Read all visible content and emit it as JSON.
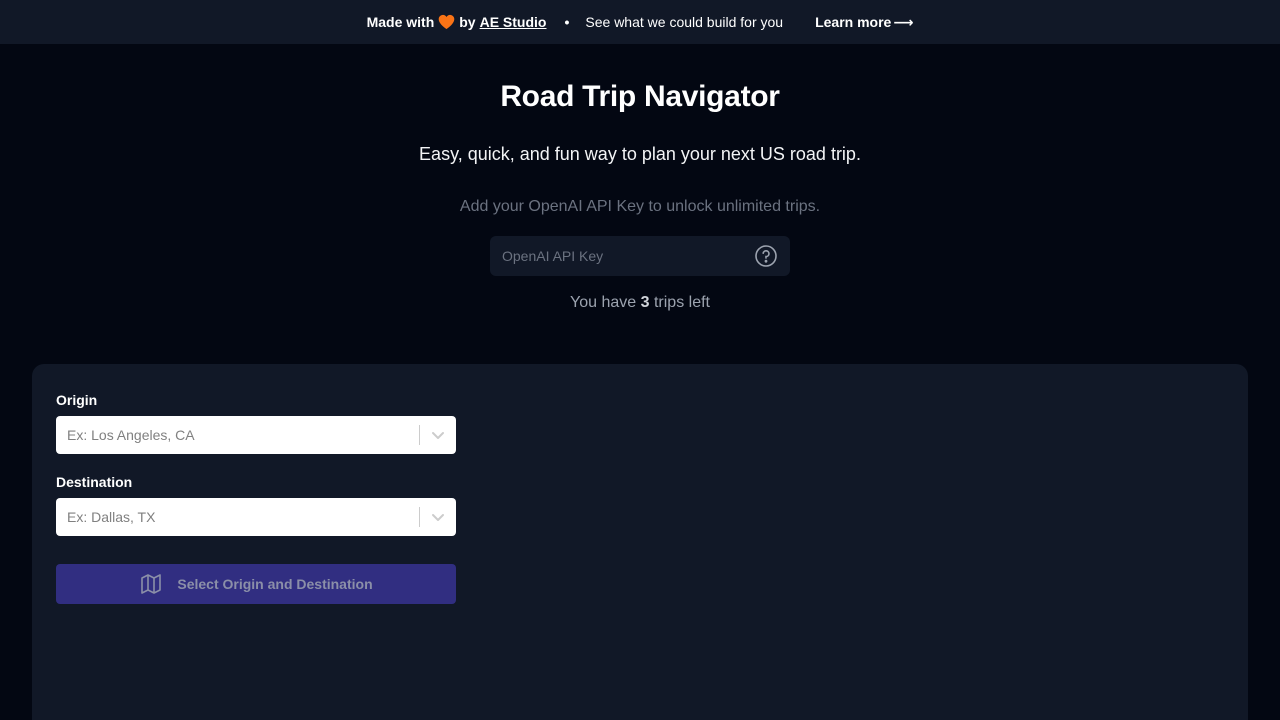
{
  "banner": {
    "made_with": "Made with",
    "by": "by",
    "studio": "AE Studio",
    "separator": "•",
    "tagline": "See what we could build for you",
    "learn_more": "Learn more",
    "arrow": "⟶",
    "heart_color": "#f97316"
  },
  "header": {
    "title": "Road Trip Navigator",
    "subtitle": "Easy, quick, and fun way to plan your next US road trip."
  },
  "api": {
    "note": "Add your OpenAI API Key to unlock unlimited trips.",
    "placeholder": "OpenAI API Key",
    "help_icon": "question-circle-icon"
  },
  "trips": {
    "prefix": "You have",
    "count": "3",
    "suffix": "trips left"
  },
  "form": {
    "origin_label": "Origin",
    "origin_placeholder": "Ex: Los Angeles, CA",
    "destination_label": "Destination",
    "destination_placeholder": "Ex: Dallas, TX",
    "submit_label": "Select Origin and Destination",
    "submit_icon": "map-icon"
  },
  "colors": {
    "background": "#030712",
    "panel": "#111827",
    "button": "#312e81"
  }
}
